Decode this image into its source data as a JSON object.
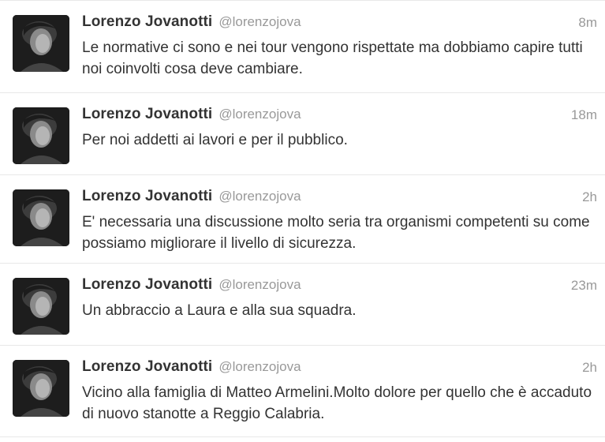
{
  "tweets": [
    {
      "name": "Lorenzo Jovanotti",
      "handle": "@lorenzojova",
      "time": "8m",
      "text": "Le normative ci sono e nei tour vengono rispettate ma dobbiamo capire tutti noi coinvolti cosa deve cambiare."
    },
    {
      "name": "Lorenzo Jovanotti",
      "handle": "@lorenzojova",
      "time": "18m",
      "text": "Per noi addetti ai lavori e per il pubblico."
    },
    {
      "name": "Lorenzo Jovanotti",
      "handle": "@lorenzojova",
      "time": "2h",
      "text": "E' necessaria una discussione molto seria tra organismi competenti su come possiamo migliorare il livello di sicurezza."
    },
    {
      "name": "Lorenzo Jovanotti",
      "handle": "@lorenzojova",
      "time": "23m",
      "text": "Un abbraccio a Laura e alla sua squadra."
    },
    {
      "name": "Lorenzo Jovanotti",
      "handle": "@lorenzojova",
      "time": "2h",
      "text": "Vicino alla famiglia di Matteo Armelini.Molto dolore per quello che è accaduto di nuovo stanotte a Reggio Calabria."
    }
  ]
}
